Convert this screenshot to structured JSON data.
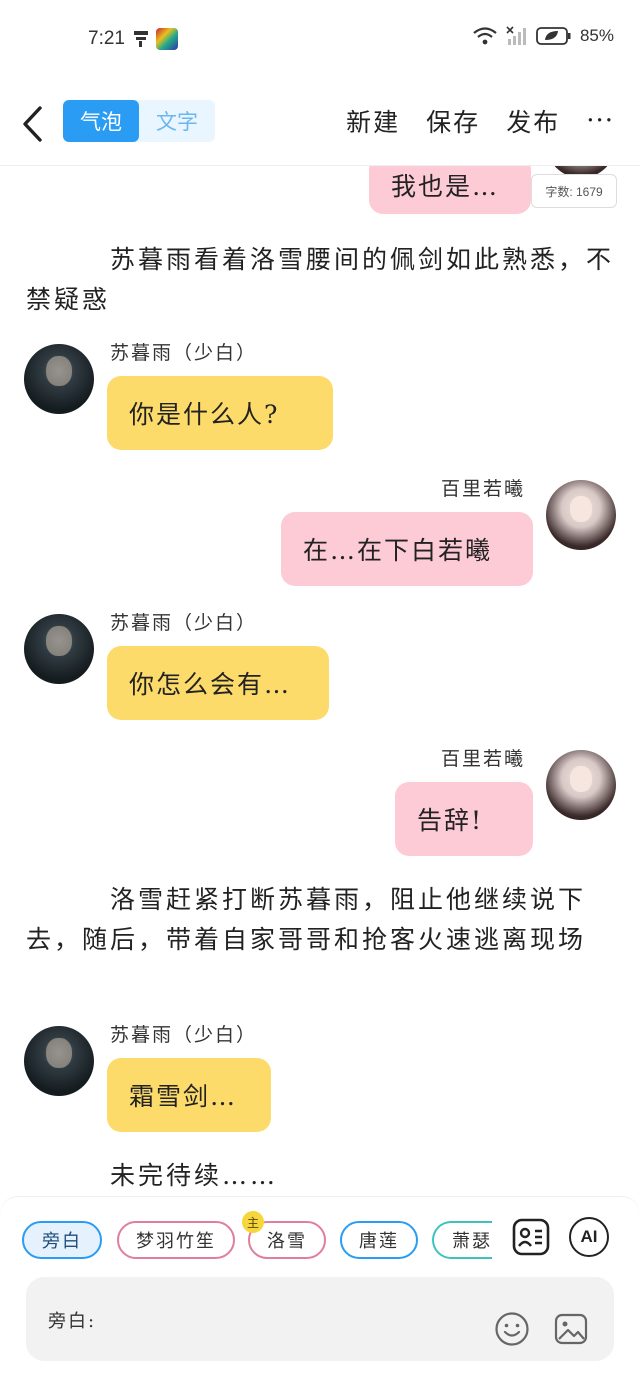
{
  "status": {
    "time": "7:21",
    "battery": "85%"
  },
  "header": {
    "seg_bubble": "气泡",
    "seg_text": "文字",
    "new_label": "新建",
    "save_label": "保存",
    "publish_label": "发布",
    "more_label": "···"
  },
  "word_count": "字数: 1679",
  "messages": {
    "m0_text": "我也是…",
    "narr1": "　　　苏暮雨看着洛雪腰间的佩剑如此熟悉，不禁疑惑",
    "m1_name": "苏暮雨（少白）",
    "m1_text": "你是什么人?",
    "m2_name": "百里若曦",
    "m2_text": "在…在下白若曦",
    "m3_name": "苏暮雨（少白）",
    "m3_text": "你怎么会有…",
    "m4_name": "百里若曦",
    "m4_text": "告辞!",
    "narr2": "　　　洛雪赶紧打断苏暮雨，阻止他继续说下去，随后，带着自家哥哥和抢客火速逃离现场",
    "m5_name": "苏暮雨（少白）",
    "m5_text": "霜雪剑…",
    "narr3": "　　　未完待续……"
  },
  "roles": {
    "r1": "旁白",
    "r2": "梦羽竹笙",
    "r3": "洛雪",
    "r3_badge": "主",
    "r4": "唐莲",
    "r5": "萧瑟"
  },
  "ai_label": "AI",
  "input": {
    "label": "旁白:"
  }
}
